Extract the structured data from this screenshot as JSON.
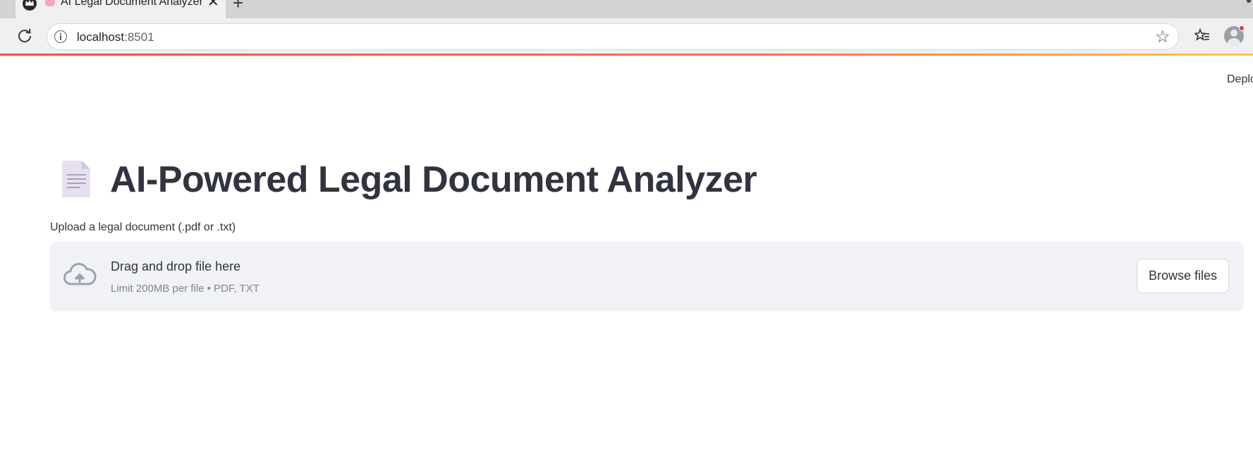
{
  "browser": {
    "tab_title": "AI Legal Document Analyzer",
    "tab_close": "✕",
    "new_tab": "+",
    "url_host": "localhost",
    "url_port": ":8501",
    "star": "☆"
  },
  "app": {
    "deploy_label": "Deplo",
    "page_icon": "page-icon",
    "title": "AI-Powered Legal Document Analyzer"
  },
  "uploader": {
    "label": "Upload a legal document (.pdf or .txt)",
    "drop_text": "Drag and drop file here",
    "limit_text": "Limit 200MB per file • PDF, TXT",
    "browse_label": "Browse files"
  },
  "colors": {
    "loading_bar_start": "#ff4b4b",
    "loading_bar_end": "#ffc845",
    "text": "#31333f",
    "dropzone_bg": "#f0f2f6",
    "muted": "#808495"
  }
}
